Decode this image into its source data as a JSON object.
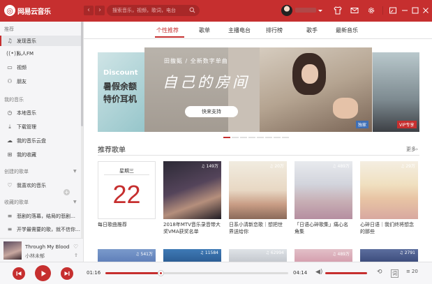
{
  "app": {
    "title": "网易云音乐"
  },
  "search": {
    "placeholder": "搜索音乐，视频，歌词，电台"
  },
  "colors": {
    "brand": "#c62f2f",
    "sidebar_bg": "#f5f5f7",
    "player_bg": "#f6f6f8"
  },
  "sidebar": {
    "recommend_header": "推荐",
    "recommend_items": [
      {
        "label": "发现音乐",
        "icon": "music-note-icon",
        "active": true
      },
      {
        "label": "私人FM",
        "icon": "radio-icon"
      },
      {
        "label": "视频",
        "icon": "video-icon"
      },
      {
        "label": "朋友",
        "icon": "friends-icon"
      }
    ],
    "my_music_header": "我的音乐",
    "my_music_items": [
      {
        "label": "本地音乐",
        "icon": "clock-icon"
      },
      {
        "label": "下载管理",
        "icon": "download-icon"
      },
      {
        "label": "我的音乐云盘",
        "icon": "cloud-icon"
      },
      {
        "label": "我的收藏",
        "icon": "collection-icon"
      }
    ],
    "created_header": "创建的歌单",
    "created_items": [
      {
        "label": "我喜欢的音乐",
        "icon": "heart-icon"
      }
    ],
    "collected_header": "收藏的歌单",
    "collected_items": [
      {
        "label": "悲剧的落幕，结局的悲剧…",
        "icon": "playlist-icon"
      },
      {
        "label": "开学最需要的歌，就不信你…",
        "icon": "playlist-icon"
      }
    ]
  },
  "now_playing": {
    "title": "Through My Blood",
    "artist": "小林未郁"
  },
  "tabs": [
    "个性推荐",
    "歌单",
    "主播电台",
    "排行榜",
    "歌手",
    "最新音乐"
  ],
  "banner": {
    "artist_line": "田馥甄 / 全新数字单曲",
    "title": "自己的房间",
    "button": "快来支持",
    "left_promo": {
      "discount": "Discount",
      "line1": "暑假余额",
      "line2": "特价耳机"
    },
    "tag_exclusive": "独家",
    "tag_vip": "VIP专享",
    "active_dot": 1,
    "dot_count": 8
  },
  "section": {
    "title": "推荐歌单",
    "more": "更多›"
  },
  "daily": {
    "week": "星期三",
    "day": "22",
    "caption": "每日歌曲推荐"
  },
  "playlists": [
    {
      "count": "149万",
      "caption": "2018年MTV音乐录音带大奖VMA获奖名单"
    },
    {
      "count": "20万",
      "caption": "日系小清新恋歌｜想把世界送给你"
    },
    {
      "count": "489万",
      "caption": "「日语心碎歌集」痛心名角集"
    },
    {
      "count": "29万",
      "caption": "心碎日语｜我们终将想念的那些"
    }
  ],
  "row2_counts": [
    "541万",
    "11584",
    "62994",
    "489万",
    "2791"
  ],
  "player": {
    "current_time": "01:16",
    "total_time": "04:14",
    "progress": 0.3,
    "playlist_count": "20"
  }
}
